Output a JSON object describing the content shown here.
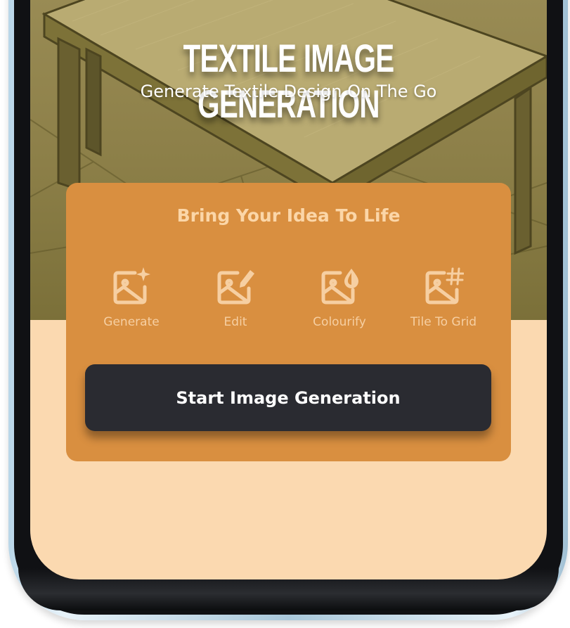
{
  "hero": {
    "title": "TEXTILE IMAGE GENERATION",
    "subtitle": "Generate Textile Design On The Go"
  },
  "card": {
    "heading": "Bring Your Idea To Life",
    "features": [
      {
        "label": "Generate",
        "icon": "image-sparkle-icon"
      },
      {
        "label": "Edit",
        "icon": "image-edit-icon"
      },
      {
        "label": "Colourify",
        "icon": "image-drop-icon"
      },
      {
        "label": "Tile To Grid",
        "icon": "image-grid-icon"
      }
    ],
    "cta_label": "Start Image Generation"
  },
  "colors": {
    "hero_tint": "#8c7f48",
    "card_bg": "#d98f40",
    "screen_bg": "#fbd9b0",
    "button_bg": "#2a2b31",
    "accent_text": "#fbd6a8"
  }
}
